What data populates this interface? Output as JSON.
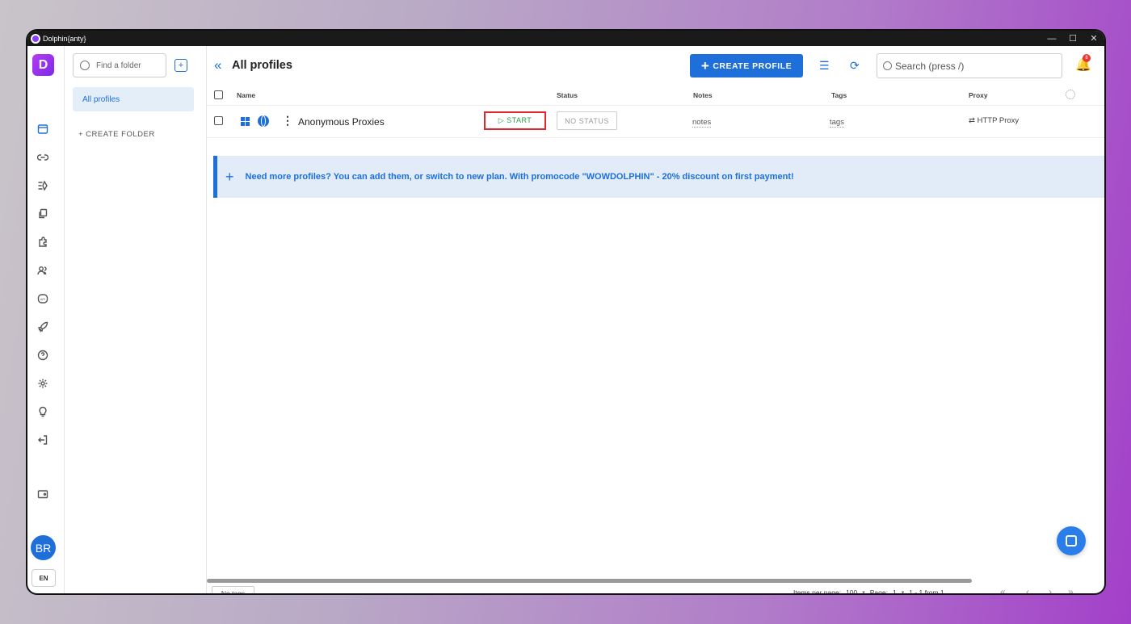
{
  "window": {
    "title": "Dolphin{anty}",
    "minimize": "—",
    "maximize": "☐",
    "close": "✕"
  },
  "rail": {
    "logo": "D",
    "icons": [
      "profiles-icon",
      "link-icon",
      "automation-icon",
      "copy-icon",
      "extensions-icon",
      "users-icon",
      "api-icon",
      "rocket-icon",
      "help-icon",
      "settings-icon",
      "bulb-icon",
      "logout-icon",
      "wallet-icon"
    ],
    "avatar": "BR",
    "language": "EN"
  },
  "folders": {
    "search_placeholder": "Find a folder",
    "items": [
      {
        "label": "All profiles"
      }
    ],
    "create_label": "+ CREATE FOLDER"
  },
  "header": {
    "collapse": "«",
    "title": "All profiles",
    "create_profile": "CREATE PROFILE",
    "search_placeholder": "Search (press /)",
    "notification_count": "8"
  },
  "table": {
    "columns": {
      "name": "Name",
      "status": "Status",
      "notes": "Notes",
      "tags": "Tags",
      "proxy": "Proxy"
    },
    "rows": [
      {
        "name": "Anonymous Proxies",
        "start": "▷ START",
        "status": "NO STATUS",
        "notes": "notes",
        "tags": "tags",
        "proxy": "⇄ HTTP Proxy"
      }
    ]
  },
  "promo": {
    "plus": "+",
    "text": "Need more profiles? You can add them, or switch to new plan. With promocode \"WOWDOLPHIN\" - 20% discount on first payment!"
  },
  "footer": {
    "no_tags": "No tags",
    "items_per_page_label": "Items per page:",
    "items_per_page": "100",
    "page_label": "Page:",
    "page": "1",
    "range": "1 - 1 from 1",
    "nav": [
      "«",
      "‹",
      "›",
      "»"
    ]
  },
  "colors": {
    "accent": "#1e6fd9",
    "start_green": "#2e9e4a",
    "highlight_red": "#e0282a",
    "promo_bg": "#e1ecf8"
  }
}
